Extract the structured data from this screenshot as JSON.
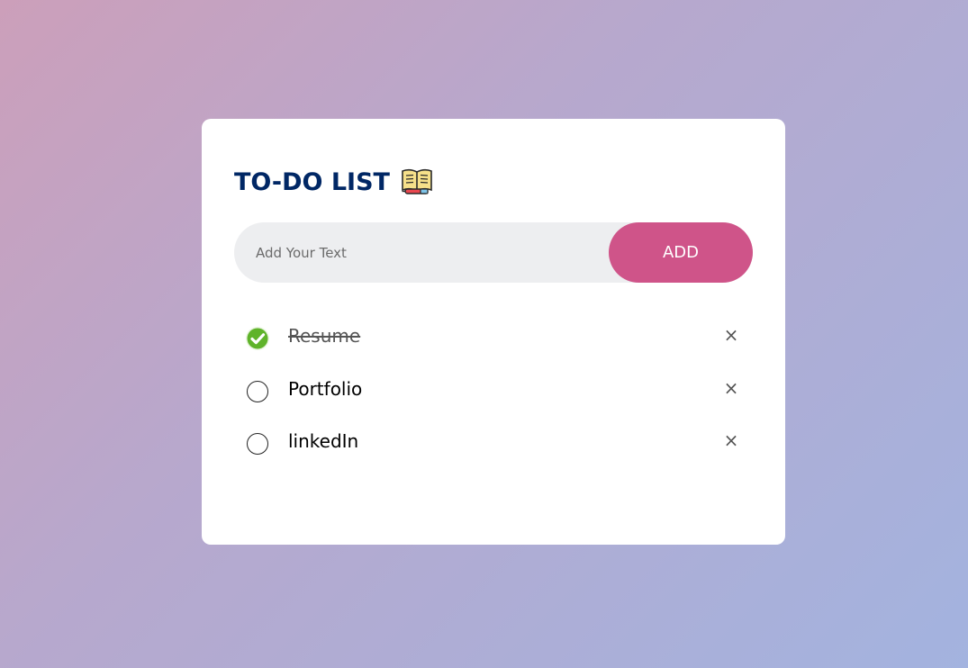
{
  "app": {
    "title": "TO-DO LIST",
    "title_icon": "book-pen-icon"
  },
  "input": {
    "placeholder": "Add Your Text",
    "value": ""
  },
  "add_button": {
    "label": "ADD",
    "color": "#cf5489"
  },
  "colors": {
    "title": "#002765",
    "checked": "#5fb32a",
    "background_start": "#cc9fba",
    "background_end": "#a3b3df"
  },
  "tasks": [
    {
      "text": "Resume",
      "done": true,
      "delete_symbol": "×"
    },
    {
      "text": "Portfolio",
      "done": false,
      "delete_symbol": "×"
    },
    {
      "text": "linkedIn",
      "done": false,
      "delete_symbol": "×"
    }
  ]
}
